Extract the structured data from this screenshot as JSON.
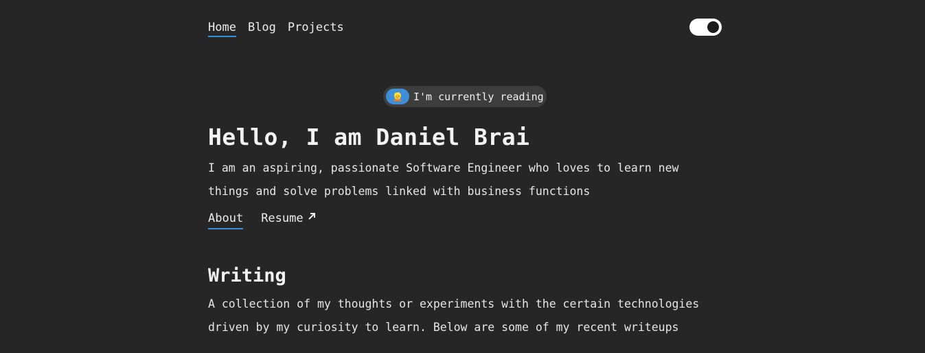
{
  "nav": {
    "items": [
      {
        "label": "Home",
        "active": true
      },
      {
        "label": "Blog",
        "active": false
      },
      {
        "label": "Projects",
        "active": false
      }
    ]
  },
  "theme_toggle": {
    "state": "on"
  },
  "reading_badge": {
    "emoji": "👱",
    "text": "I'm currently reading"
  },
  "hero": {
    "title": "Hello, I am Daniel Brai",
    "description": "I am an aspiring, passionate Software Engineer who loves to learn new things and solve problems linked with business functions"
  },
  "links": {
    "about": "About",
    "resume": "Resume"
  },
  "writing": {
    "title": "Writing",
    "description": "A collection of my thoughts or experiments with the certain technologies driven by my curiosity to learn. Below are some of my recent writeups"
  },
  "colors": {
    "background": "#262626",
    "accent": "#3b8fe0",
    "pill_background": "#3d3d3d"
  }
}
